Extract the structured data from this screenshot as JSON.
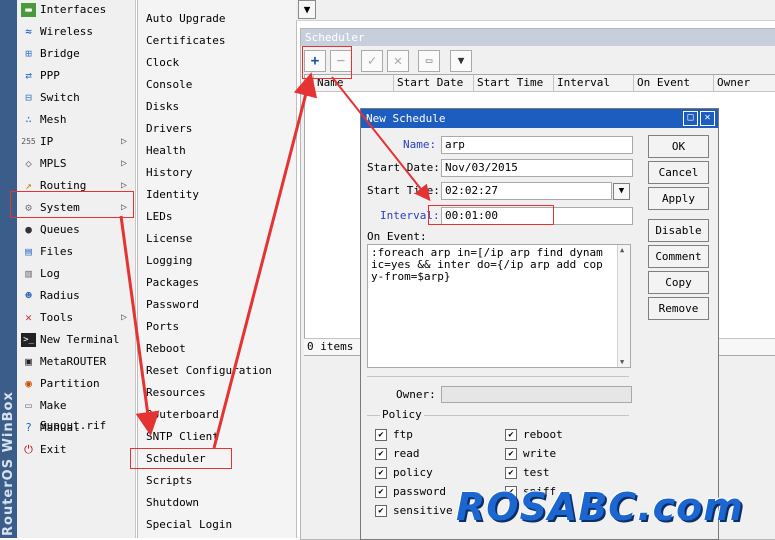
{
  "brand": "RouterOS WinBox",
  "main_menu": [
    {
      "label": "Interfaces",
      "icon": "interfaces-icon",
      "glyph": "▬",
      "submenu": false
    },
    {
      "label": "Wireless",
      "icon": "wireless-icon",
      "glyph": "≈",
      "submenu": false
    },
    {
      "label": "Bridge",
      "icon": "bridge-icon",
      "glyph": "⊞",
      "submenu": false
    },
    {
      "label": "PPP",
      "icon": "ppp-icon",
      "glyph": "⇄",
      "submenu": false
    },
    {
      "label": "Switch",
      "icon": "switch-icon",
      "glyph": "⊟",
      "submenu": false
    },
    {
      "label": "Mesh",
      "icon": "mesh-icon",
      "glyph": "∴",
      "submenu": false
    },
    {
      "label": "IP",
      "icon": "ip-icon",
      "glyph": "255",
      "submenu": true
    },
    {
      "label": "MPLS",
      "icon": "mpls-icon",
      "glyph": "◇",
      "submenu": true
    },
    {
      "label": "Routing",
      "icon": "routing-icon",
      "glyph": "↗",
      "submenu": true
    },
    {
      "label": "System",
      "icon": "system-gear-icon",
      "glyph": "⚙",
      "submenu": true
    },
    {
      "label": "Queues",
      "icon": "queues-icon",
      "glyph": "●",
      "submenu": false
    },
    {
      "label": "Files",
      "icon": "files-icon",
      "glyph": "▤",
      "submenu": false
    },
    {
      "label": "Log",
      "icon": "log-icon",
      "glyph": "▥",
      "submenu": false
    },
    {
      "label": "Radius",
      "icon": "radius-icon",
      "glyph": "☻",
      "submenu": false
    },
    {
      "label": "Tools",
      "icon": "tools-icon",
      "glyph": "✕",
      "submenu": true
    },
    {
      "label": "New Terminal",
      "icon": "terminal-icon",
      "glyph": ">_",
      "submenu": false
    },
    {
      "label": "MetaROUTER",
      "icon": "metarouter-icon",
      "glyph": "▣",
      "submenu": false
    },
    {
      "label": "Partition",
      "icon": "partition-icon",
      "glyph": "◉",
      "submenu": false
    },
    {
      "label": "Make Supout.rif",
      "icon": "supout-icon",
      "glyph": "▭",
      "submenu": false
    },
    {
      "label": "Manual",
      "icon": "manual-icon",
      "glyph": "?",
      "submenu": false
    },
    {
      "label": "Exit",
      "icon": "exit-icon",
      "glyph": "⏻",
      "submenu": false
    }
  ],
  "system_submenu": [
    "Auto Upgrade",
    "Certificates",
    "Clock",
    "Console",
    "Disks",
    "Drivers",
    "Health",
    "History",
    "Identity",
    "LEDs",
    "License",
    "Logging",
    "Packages",
    "Password",
    "Ports",
    "Reboot",
    "Reset Configuration",
    "Resources",
    "Routerboard",
    "SNTP Client",
    "Scheduler",
    "Scripts",
    "Shutdown",
    "Special Login"
  ],
  "scheduler": {
    "title": "Scheduler",
    "columns": [
      "Name",
      "Start Date",
      "Start Time",
      "Interval",
      "On Event",
      "Owner"
    ],
    "status": "0 items",
    "toolbar": {
      "add": "+",
      "remove": "−",
      "enable": "✓",
      "disable": "✕",
      "comment": "▭",
      "filter": "▼"
    }
  },
  "dialog": {
    "title": "New Schedule",
    "name_label": "Name:",
    "name_value": "arp",
    "start_date_label": "Start Date:",
    "start_date_value": "Nov/03/2015",
    "start_time_label": "Start Time:",
    "start_time_value": "02:02:27",
    "interval_label": "Interval:",
    "interval_value": "00:01:00",
    "on_event_label": "On Event:",
    "on_event_value": ":foreach arp in=[/ip arp find dynamic=yes && inter do={/ip arp add copy-from=$arp}",
    "owner_label": "Owner:",
    "policy_label": "Policy",
    "policies": [
      {
        "label": "ftp",
        "checked": true
      },
      {
        "label": "reboot",
        "checked": true
      },
      {
        "label": "read",
        "checked": true
      },
      {
        "label": "write",
        "checked": true
      },
      {
        "label": "policy",
        "checked": true
      },
      {
        "label": "test",
        "checked": true
      },
      {
        "label": "password",
        "checked": true
      },
      {
        "label": "sniff",
        "checked": true
      },
      {
        "label": "sensitive",
        "checked": true
      }
    ],
    "buttons": {
      "ok": "OK",
      "cancel": "Cancel",
      "apply": "Apply",
      "disable": "Disable",
      "comment": "Comment",
      "copy": "Copy",
      "remove": "Remove"
    },
    "window_controls": {
      "restore": "□",
      "close": "✕"
    }
  },
  "watermark": "ROSABC.com",
  "colors": {
    "title_active": "#1c5dbf",
    "title_inactive": "#c6cfdb",
    "annotation": "#e53333",
    "label_blue": "#2a3fbf",
    "watermark": "#1b66d0"
  }
}
